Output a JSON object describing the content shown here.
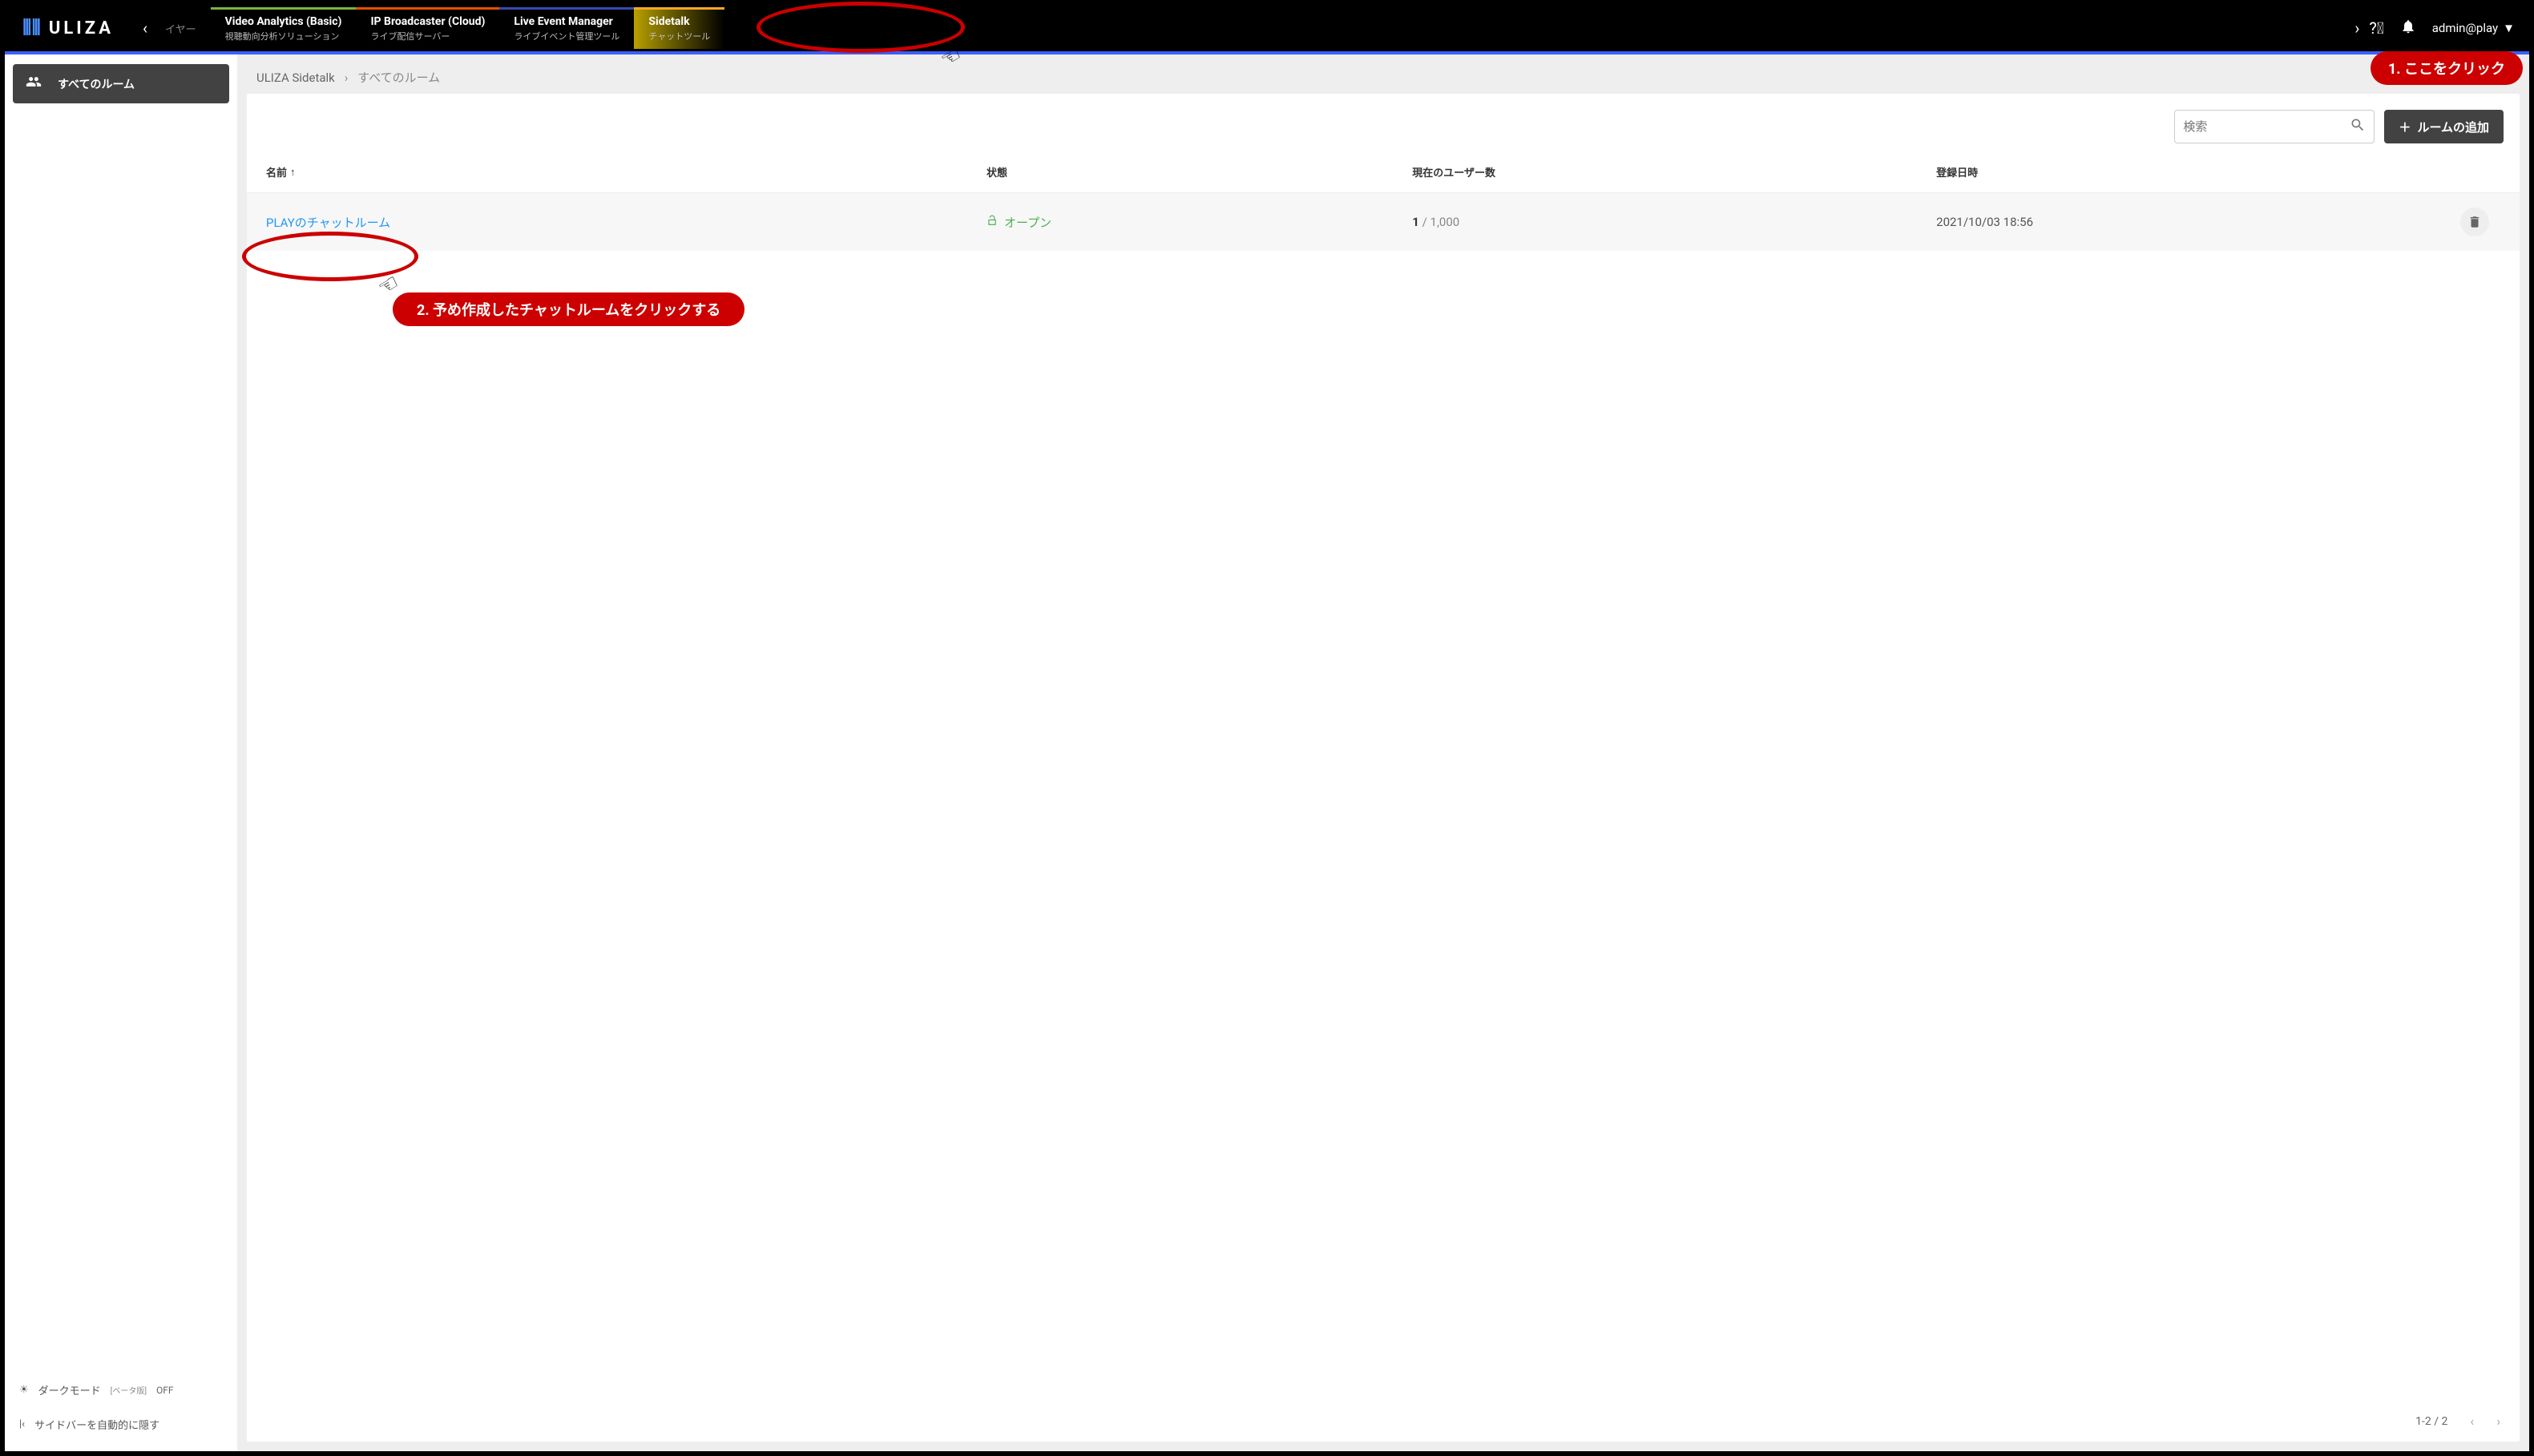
{
  "header": {
    "logo": "ULIZA",
    "player_fragment": "イヤー",
    "tabs": [
      {
        "title": "Video Analytics (Basic)",
        "sub": "視聴動向分析ソリューション"
      },
      {
        "title": "IP Broadcaster (Cloud)",
        "sub": "ライブ配信サーバー"
      },
      {
        "title": "Live Event Manager",
        "sub": "ライブイベント管理ツール"
      },
      {
        "title": "Sidetalk",
        "sub": "チャットツール"
      }
    ],
    "user": "admin@play"
  },
  "sidebar": {
    "all_rooms": "すべてのルーム",
    "dark_mode_label": "ダークモード",
    "beta": "[ベータ版]",
    "dark_mode_state": "OFF",
    "auto_hide": "サイドバーを自動的に隠す"
  },
  "breadcrumb": {
    "root": "ULIZA Sidetalk",
    "current": "すべてのルーム"
  },
  "toolbar": {
    "search_placeholder": "検索",
    "add_room": "ルームの追加"
  },
  "table": {
    "headers": {
      "name": "名前",
      "status": "状態",
      "users": "現在のユーザー数",
      "date": "登録日時"
    },
    "rows": [
      {
        "name": "PLAYのチャットルーム",
        "status": "オープン",
        "users_current": "1",
        "users_max": "1,000",
        "date": "2021/10/03 18:56"
      }
    ]
  },
  "footer": {
    "pagination": "1-2 / 2"
  },
  "annotations": {
    "a1": "1.  ここをクリック",
    "a2": "2.  予め作成したチャットルームをクリックする"
  }
}
